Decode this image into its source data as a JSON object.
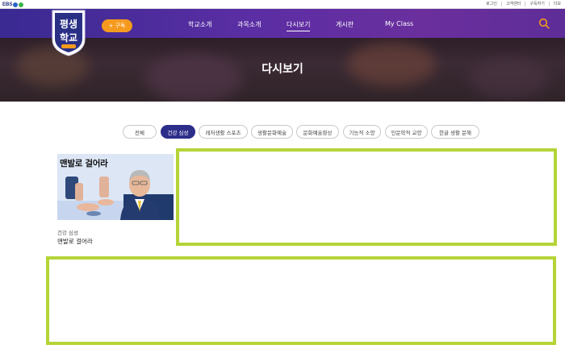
{
  "topbar": {
    "brand": "EBS",
    "utility_links": [
      "로그인",
      "고객센터",
      "구독하기",
      "더보"
    ]
  },
  "header": {
    "logo_text_top": "평생",
    "logo_text_bottom": "학교",
    "subscribe_label": "구독",
    "menu": [
      {
        "label": "학교소개",
        "active": false
      },
      {
        "label": "과목소개",
        "active": false
      },
      {
        "label": "다시보기",
        "active": true
      },
      {
        "label": "게시판",
        "active": false
      },
      {
        "label": "My Class",
        "active": false
      }
    ]
  },
  "hero": {
    "title": "다시보기"
  },
  "filters": [
    {
      "label": "전체",
      "active": false
    },
    {
      "label": "건강 심성",
      "active": true
    },
    {
      "label": "레저생활 스포츠",
      "active": false
    },
    {
      "label": "생활문화예술",
      "active": false
    },
    {
      "label": "문화예술향상",
      "active": false
    },
    {
      "label": "기능적 소양",
      "active": false
    },
    {
      "label": "인문학적 교양",
      "active": false
    },
    {
      "label": "한글 생활 문해",
      "active": false
    }
  ],
  "cards": [
    {
      "thumb_title": "맨발로 걸어라",
      "category": "건강 심성",
      "title": "맨발로 걸어라"
    }
  ],
  "colors": {
    "nav_purple": "#5b2ea4",
    "accent_orange": "#f59a1e",
    "active_chip": "#2d2e8a",
    "placeholder_border": "#b4d438"
  }
}
